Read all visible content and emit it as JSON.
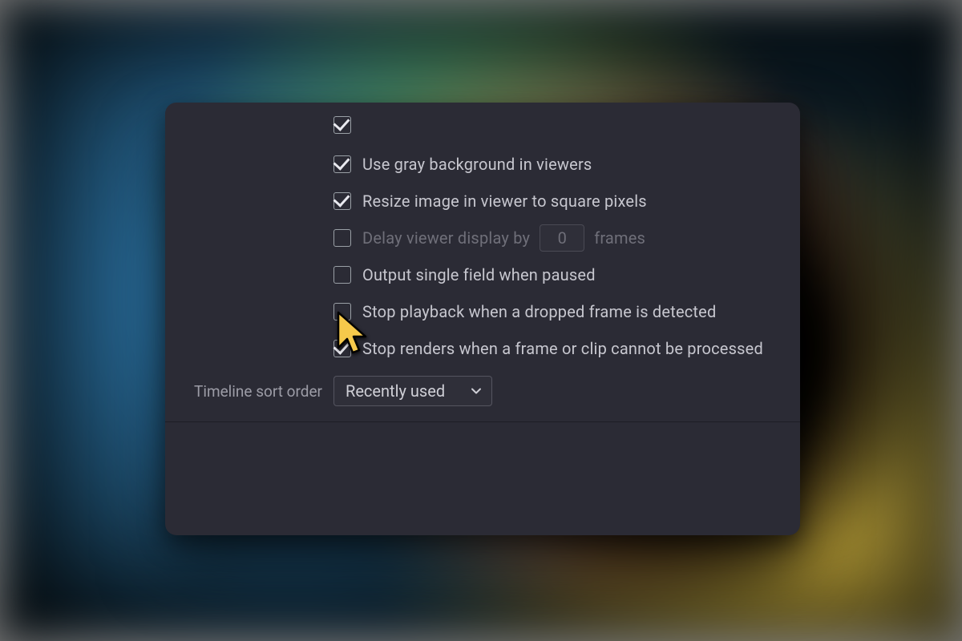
{
  "options": {
    "gray_bg": {
      "label": "Use gray background in viewers",
      "checked": true
    },
    "resize_square": {
      "label": "Resize image in viewer to square pixels",
      "checked": true
    },
    "delay_viewer": {
      "label": "Delay viewer display by",
      "checked": false,
      "value": "0",
      "suffix": "frames"
    },
    "output_single_field": {
      "label": "Output single field when paused",
      "checked": false
    },
    "stop_playback": {
      "label": "Stop playback when a dropped frame is detected",
      "checked": false
    },
    "stop_renders": {
      "label": "Stop renders when a frame or clip cannot be processed",
      "checked": true
    }
  },
  "timeline_sort": {
    "label": "Timeline sort order",
    "value": "Recently used"
  }
}
